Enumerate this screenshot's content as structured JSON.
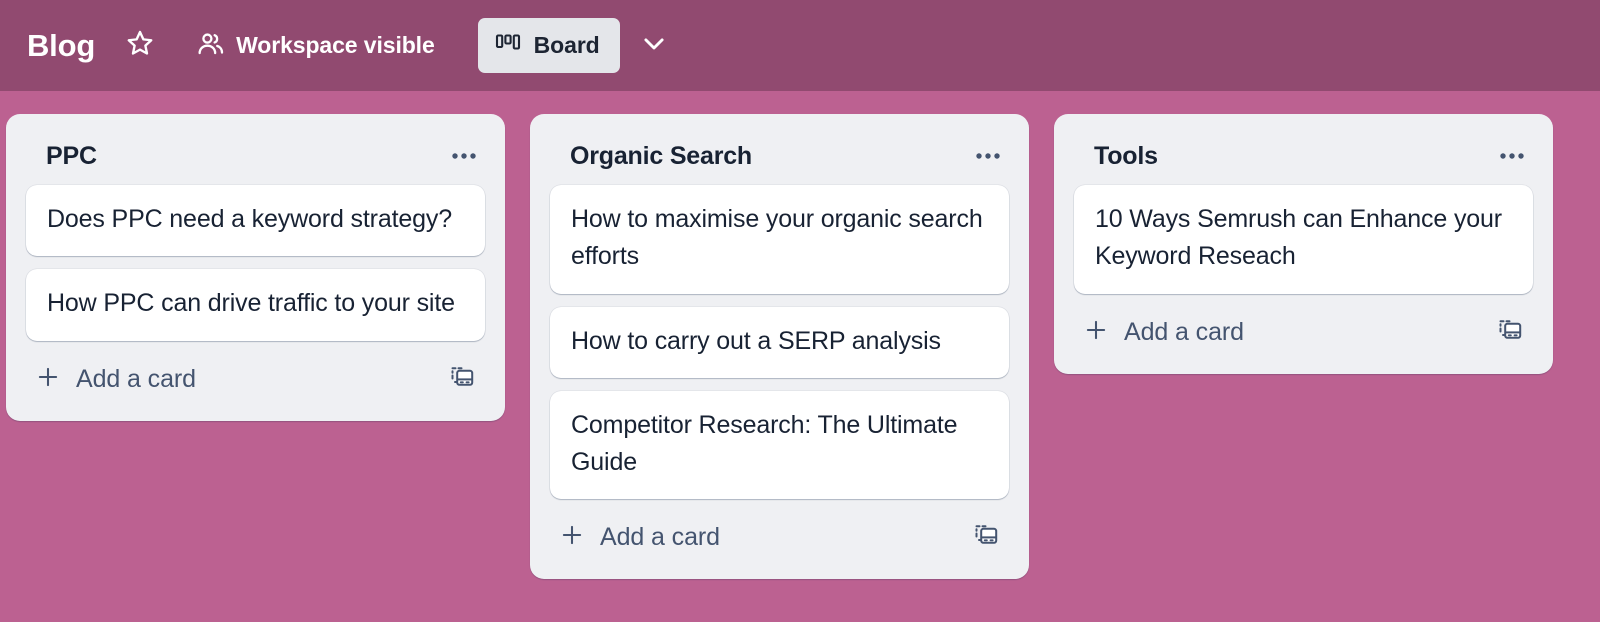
{
  "colors": {
    "header_bg": "#914a70",
    "board_bg": "#bc6191",
    "list_bg": "#eff0f3",
    "card_bg": "#ffffff",
    "text_dark": "#182233",
    "text_muted": "#44546f",
    "view_button_bg": "#e4e6ea"
  },
  "header": {
    "board_name": "Blog",
    "star_icon": "star-outline-icon",
    "visibility_icon": "workspace-members-icon",
    "visibility_label": "Workspace visible",
    "view_icon": "board-view-icon",
    "view_label": "Board",
    "view_chevron_icon": "chevron-down-icon"
  },
  "board": {
    "lists": [
      {
        "title": "PPC",
        "menu_icon": "list-actions-ellipsis-icon",
        "cards": [
          {
            "title": "Does PPC need a keyword strategy?"
          },
          {
            "title": "How PPC can drive traffic to your site"
          }
        ],
        "add_card_icon": "plus-icon",
        "add_card_label": "Add a card",
        "template_icon": "card-template-icon"
      },
      {
        "title": "Organic Search",
        "menu_icon": "list-actions-ellipsis-icon",
        "cards": [
          {
            "title": "How to maximise your organic search efforts"
          },
          {
            "title": "How to carry out a SERP analysis"
          },
          {
            "title": "Competitor Research: The Ultimate Guide"
          }
        ],
        "add_card_icon": "plus-icon",
        "add_card_label": "Add a card",
        "template_icon": "card-template-icon"
      },
      {
        "title": "Tools",
        "menu_icon": "list-actions-ellipsis-icon",
        "cards": [
          {
            "title": "10 Ways Semrush can Enhance your Keyword Reseach"
          }
        ],
        "add_card_icon": "plus-icon",
        "add_card_label": "Add a card",
        "template_icon": "card-template-icon"
      }
    ]
  }
}
